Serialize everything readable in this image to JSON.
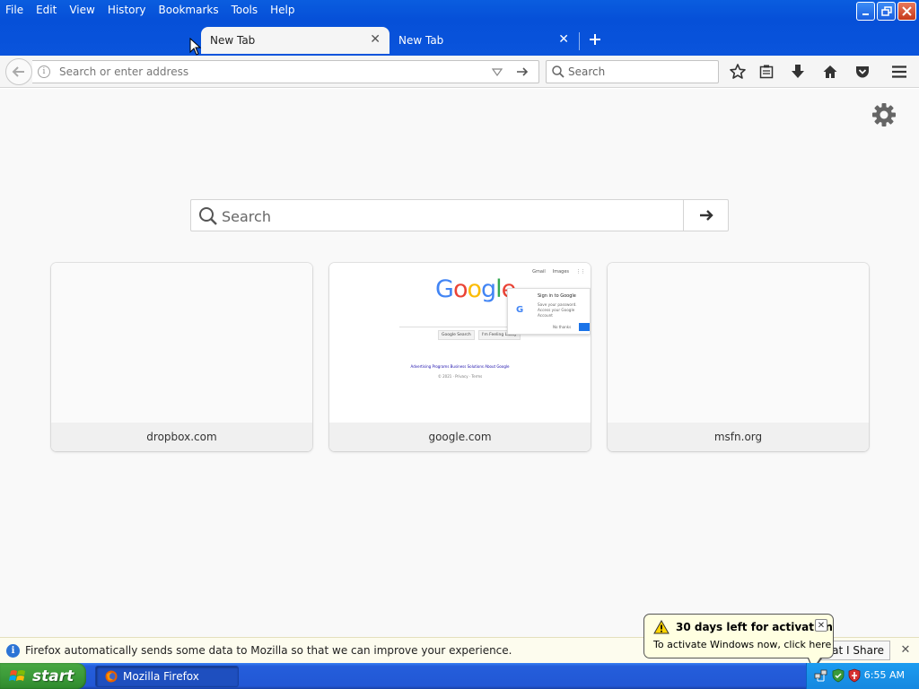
{
  "window": {
    "menu": [
      "File",
      "Edit",
      "View",
      "History",
      "Bookmarks",
      "Tools",
      "Help"
    ]
  },
  "tabs": [
    {
      "label": "New Tab",
      "active": true
    },
    {
      "label": "New Tab",
      "active": false
    }
  ],
  "navbar": {
    "url_placeholder": "Search or enter address",
    "search_placeholder": "Search"
  },
  "newtab": {
    "search_placeholder": "Search",
    "tiles": [
      {
        "label": "dropbox.com"
      },
      {
        "label": "google.com"
      },
      {
        "label": "msfn.org"
      }
    ]
  },
  "google_thumb": {
    "logo": "Google",
    "top_links": [
      "Gmail",
      "Images"
    ],
    "buttons": [
      "Google Search",
      "I'm Feeling Lucky"
    ],
    "links": "Advertising Programs    Business Solutions    About Google",
    "footer": "© 2021 · Privacy · Terms",
    "popup_title": "Sign in to Google",
    "popup_body": "Save your password. Access your Google Account",
    "popup_no": "No thanks"
  },
  "notification": {
    "text": "Firefox automatically sends some data to Mozilla so that we can improve your experience.",
    "button": "hat I Share"
  },
  "balloon": {
    "title": "30 days left for activation",
    "body": "To activate Windows now, click here"
  },
  "taskbar": {
    "start": "start",
    "task": "Mozilla Firefox",
    "clock": "6:55 AM"
  },
  "colors": {
    "titlebar": "#0a5ddf",
    "taskbar": "#245edb",
    "start": "#3c9b39"
  }
}
